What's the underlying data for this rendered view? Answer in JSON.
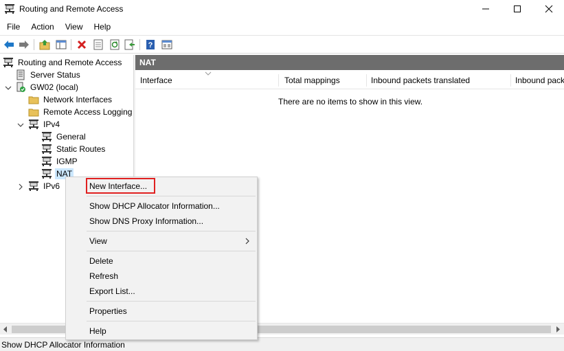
{
  "window": {
    "title": "Routing and Remote Access",
    "icon": "server-icon"
  },
  "menu": [
    "File",
    "Action",
    "View",
    "Help"
  ],
  "toolbar_icons": [
    "back-arrow-icon",
    "forward-arrow-icon",
    "up-folder-icon",
    "show-hide-tree-icon",
    "delete-icon",
    "properties-icon",
    "refresh-icon",
    "export-icon",
    "help-icon",
    "console-icon"
  ],
  "tree": {
    "root": "Routing and Remote Access",
    "server_status": "Server Status",
    "server": "GW02 (local)",
    "network_interfaces": "Network Interfaces",
    "remote_access_logging": "Remote Access Logging",
    "ipv4": "IPv4",
    "general": "General",
    "static_routes": "Static Routes",
    "igmp": "IGMP",
    "nat": "NAT",
    "ipv6": "IPv6"
  },
  "right_pane": {
    "header": "NAT",
    "columns": [
      "Interface",
      "Total mappings",
      "Inbound packets translated",
      "Inbound pack"
    ],
    "empty_message": "There are no items to show in this view."
  },
  "context_menu": {
    "new_interface": "New Interface...",
    "show_dhcp": "Show DHCP Allocator Information...",
    "show_dns": "Show DNS Proxy Information...",
    "view": "View",
    "delete": "Delete",
    "refresh": "Refresh",
    "export_list": "Export List...",
    "properties": "Properties",
    "help": "Help"
  },
  "status_bar": "Show DHCP Allocator Information",
  "colors": {
    "header_bg": "#6d6d6d",
    "selection": "#cce8ff",
    "highlight_border": "#e02020",
    "menu_bg": "#f2f2f2"
  }
}
